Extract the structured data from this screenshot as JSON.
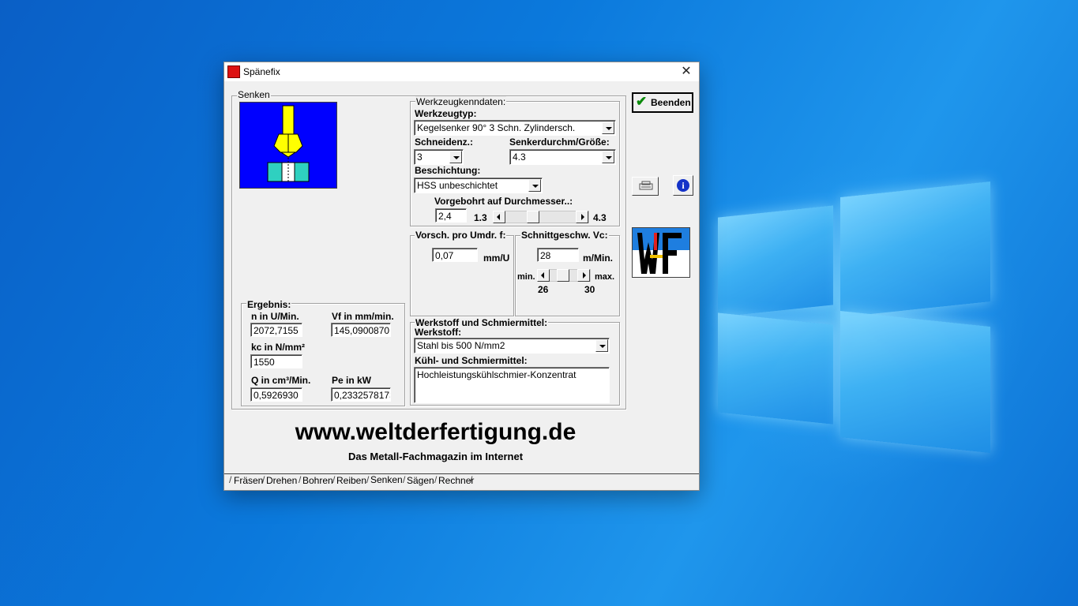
{
  "window": {
    "title": "Spänefix",
    "close_icon": "close-icon"
  },
  "senken": {
    "group_label": "Senken"
  },
  "werkzeug": {
    "group_label": "Werkzeugkenndaten:",
    "typ_label": "Werkzeugtyp:",
    "typ_value": "Kegelsenker 90°  3 Schn. Zylindersch.",
    "schneidenz_label": "Schneidenz.:",
    "schneidenz_value": "3",
    "senkerdurch_label": "Senkerdurchm/Größe:",
    "senkerdurch_value": "4.3",
    "beschichtung_label": "Beschichtung:",
    "beschichtung_value": "HSS unbeschichtet",
    "vorgebohrt_label": "Vorgebohrt auf Durchmesser..:",
    "vorgebohrt_value": "2,4",
    "vorgebohrt_min": "1.3",
    "vorgebohrt_max": "4.3"
  },
  "vorschub": {
    "group_label": "Vorsch. pro Umdr. f:",
    "value": "0,07",
    "unit": "mm/U"
  },
  "schnitt": {
    "group_label": "Schnittgeschw. Vc:",
    "value": "28",
    "unit": "m/Min.",
    "min_label": "min.",
    "max_label": "max.",
    "min_value": "26",
    "max_value": "30"
  },
  "ergebnis": {
    "group_label": "Ergebnis:",
    "n_label": "n in U/Min.",
    "n_value": "2072,7155",
    "vf_label": "Vf in mm/min.",
    "vf_value": "145,0900870",
    "kc_label": "kc in N/mm²",
    "kc_value": "1550",
    "q_label": "Q in cm³/Min.",
    "q_value": "0,5926930",
    "pe_label": "Pe in kW",
    "pe_value": "0,2332578173"
  },
  "werkstoff": {
    "group_label": "Werkstoff und Schmiermittel:",
    "werkstoff_label": "Werkstoff:",
    "werkstoff_value": "Stahl bis 500 N/mm2",
    "kuehl_label": "Kühl- und Schmiermittel:",
    "kuehl_value": "Hochleistungskühlschmier-Konzentrat"
  },
  "buttons": {
    "beenden": "Beenden"
  },
  "footer": {
    "site": "www.weltderfertigung.de",
    "subtitle": "Das Metall-Fachmagazin im Internet"
  },
  "tabs": [
    "Fräsen",
    "Drehen",
    "Bohren",
    "Reiben",
    "Senken",
    "Sägen",
    "Rechner"
  ]
}
